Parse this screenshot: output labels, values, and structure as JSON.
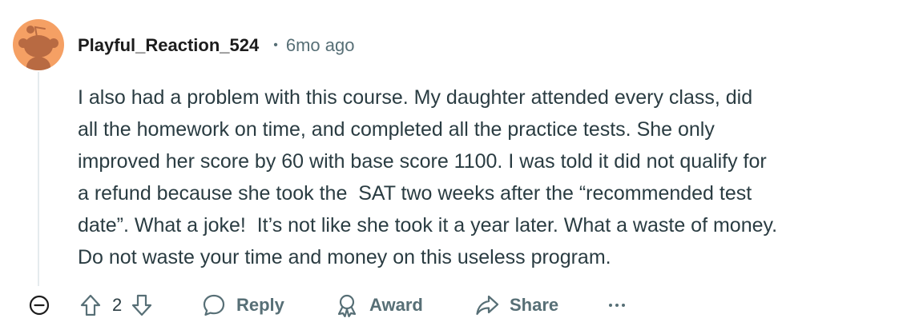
{
  "comment": {
    "author": "Playful_Reaction_524",
    "separator": "•",
    "timestamp": "6mo ago",
    "avatar_icon": "snoo-avatar-icon",
    "body_lines": [
      "I also had a problem with this course. My daughter attended every class, did",
      "all the homework on time, and completed all the practice tests. She only",
      "improved her score by 60 with base score 1100. I was told it did not qualify for",
      "a refund because she took the  SAT two weeks after the “recommended test",
      "date”. What a joke!  It’s not like she took it a year later. What a waste of money.",
      "Do not waste your time and money on this useless program."
    ]
  },
  "actions": {
    "collapse_icon": "collapse-minus-icon",
    "upvote_icon": "upvote-arrow-icon",
    "downvote_icon": "downvote-arrow-icon",
    "vote_count": "2",
    "reply_label": "Reply",
    "reply_icon": "speech-bubble-icon",
    "award_label": "Award",
    "award_icon": "award-ribbon-icon",
    "share_label": "Share",
    "share_icon": "share-arrow-icon",
    "more_label": "···",
    "more_icon": "more-options-icon"
  },
  "colors": {
    "avatar_bg": "#f5a064",
    "snoo_body": "#b86a42",
    "muted_text": "#576f76",
    "body_text": "#2a3c42",
    "username_text": "#1c1c1c",
    "thread_line": "#e5ebee"
  }
}
